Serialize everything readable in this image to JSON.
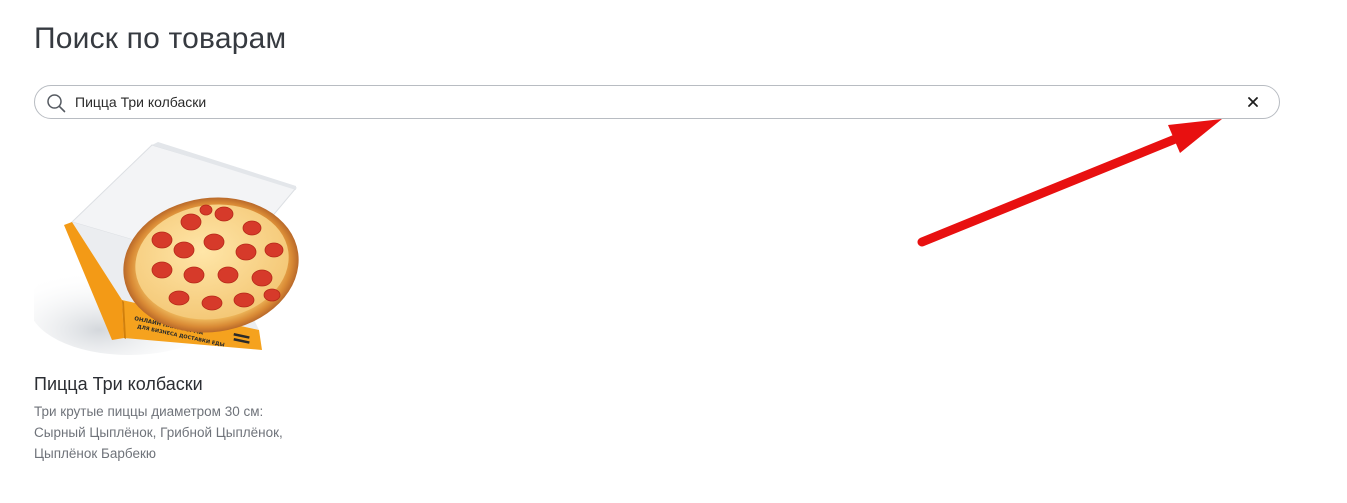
{
  "page": {
    "title": "Поиск по товарам"
  },
  "search": {
    "value": "Пицца Три колбаски",
    "icon": "search-icon",
    "clear_icon": "close-icon"
  },
  "results": [
    {
      "name": "Пицца Три колбаски",
      "description": "Три крутые пиццы диаметром 30 см: Сырный Цыплёнок, Грибной Цыплёнок, Цыплёнок Барбекю",
      "image": "pizza-box-image",
      "box_text": "ОНЛАЙН ПЛАТФОРМА ДЛЯ БИЗНЕСА ДОСТАВКИ ЕДЫ"
    }
  ],
  "annotation": {
    "arrow_color": "#e81010"
  }
}
